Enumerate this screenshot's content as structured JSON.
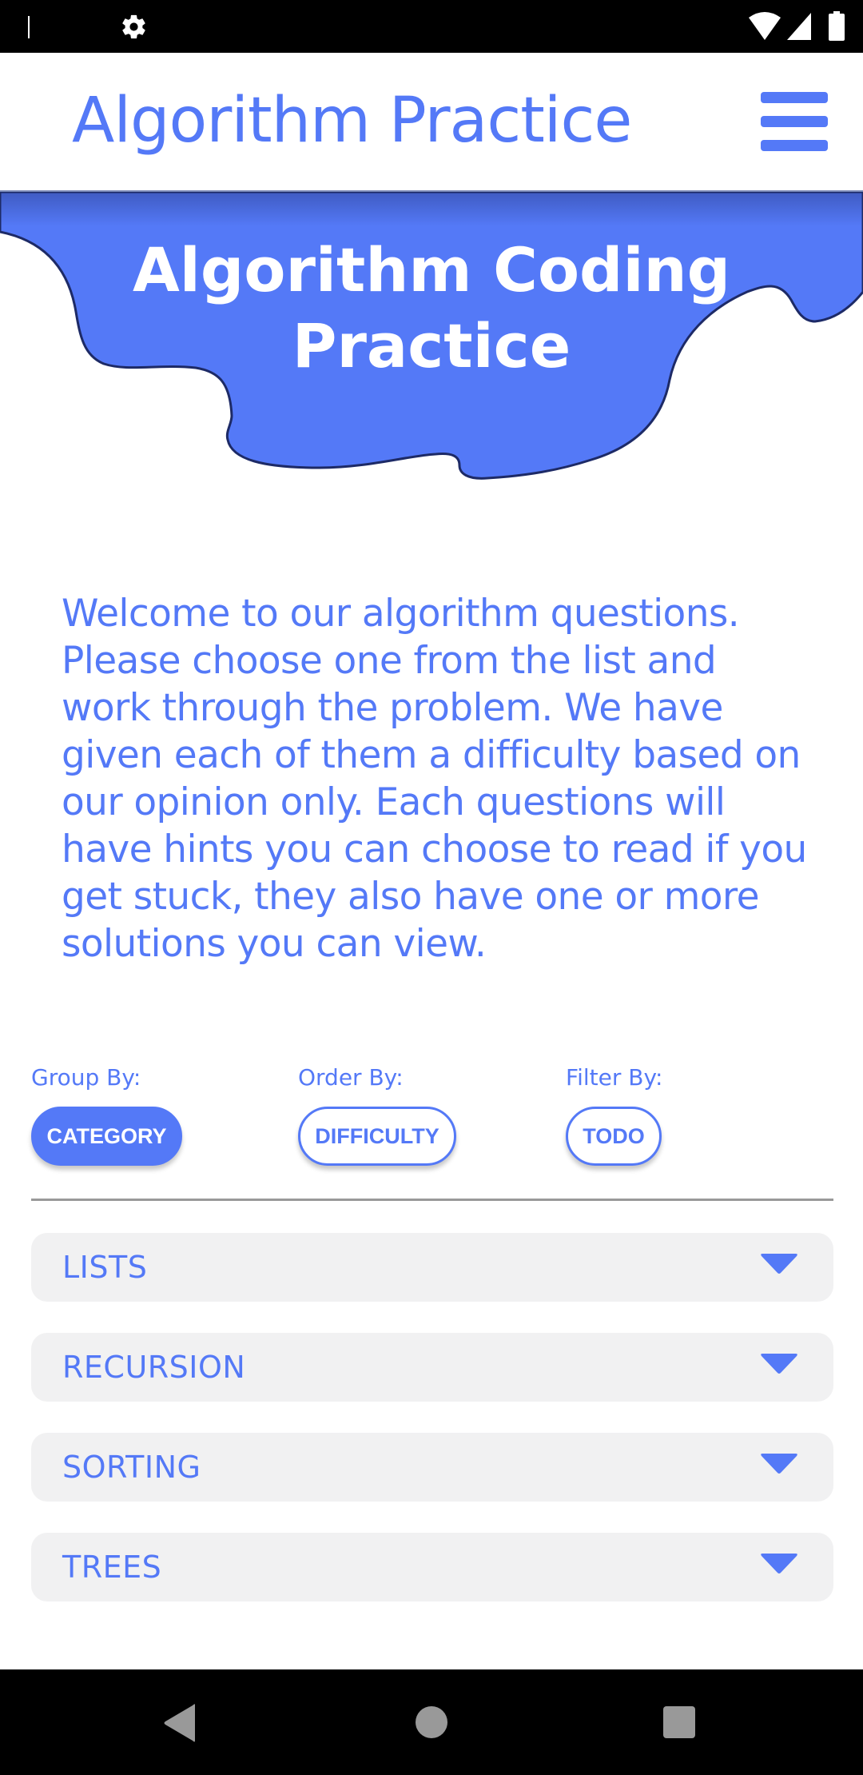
{
  "status_bar": {
    "icons": [
      "cursor-mark",
      "settings-gear-icon",
      "wifi-icon",
      "cell-signal-icon",
      "battery-icon"
    ]
  },
  "header": {
    "title": "Algorithm Practice",
    "menu_icon": "hamburger-menu-icon"
  },
  "hero": {
    "title": "Algorithm Coding Practice",
    "blob_color": "#5479f7"
  },
  "intro": {
    "text": "Welcome to our algorithm questions. Please choose one from the list and work through the problem. We have given each of them a difficulty based on our opinion only. Each questions will have hints you can choose to read if you get stuck, they also have one or more solutions you can view."
  },
  "controls": {
    "group_by": {
      "label": "Group By:",
      "button": "CATEGORY",
      "active": true
    },
    "order_by": {
      "label": "Order By:",
      "button": "DIFFICULTY",
      "active": false
    },
    "filter_by": {
      "label": "Filter By:",
      "button": "TODO",
      "active": false
    }
  },
  "categories": [
    {
      "label": "LISTS",
      "icon": "caret-down-icon"
    },
    {
      "label": "RECURSION",
      "icon": "caret-down-icon"
    },
    {
      "label": "SORTING",
      "icon": "caret-down-icon"
    },
    {
      "label": "TREES",
      "icon": "caret-down-icon"
    }
  ],
  "colors": {
    "accent": "#5479f7",
    "accordion_bg": "#f1f1f2",
    "divider": "#999999"
  },
  "nav_bar": {
    "buttons": [
      "back-icon",
      "home-icon",
      "recents-icon"
    ]
  }
}
